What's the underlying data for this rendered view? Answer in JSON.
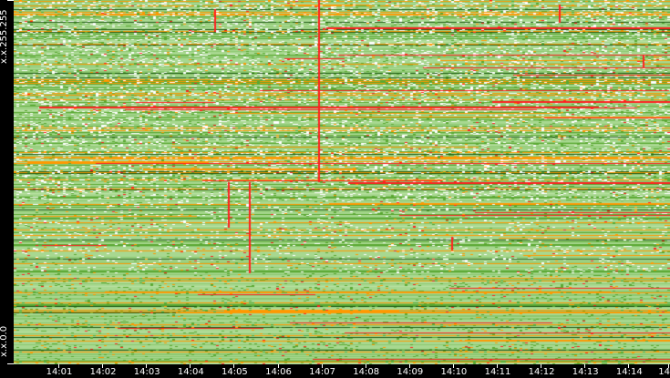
{
  "chart_data": {
    "type": "heatmap",
    "title": "",
    "xlabel": "",
    "ylabel": "",
    "y_labels": [
      "x.x.255.255",
      "x.x.0.0"
    ],
    "x_tick_labels": [
      "14:01",
      "14:02",
      "14:03",
      "14:04",
      "14:05",
      "14:06",
      "14:07",
      "14:08",
      "14:09",
      "14:10",
      "14:11",
      "14:12",
      "14:13",
      "14:14",
      "14"
    ],
    "x_range": [
      "14:00",
      "14:15"
    ],
    "y_range": [
      "x.x.0.0",
      "x.x.255.255"
    ],
    "colors": {
      "background": "#000000",
      "low": "#a8d890",
      "mid": "#5aa832",
      "dark": "#1e5a14",
      "high": "#ff9900",
      "peak": "#ff2020",
      "sparse": "#ffffff"
    }
  }
}
